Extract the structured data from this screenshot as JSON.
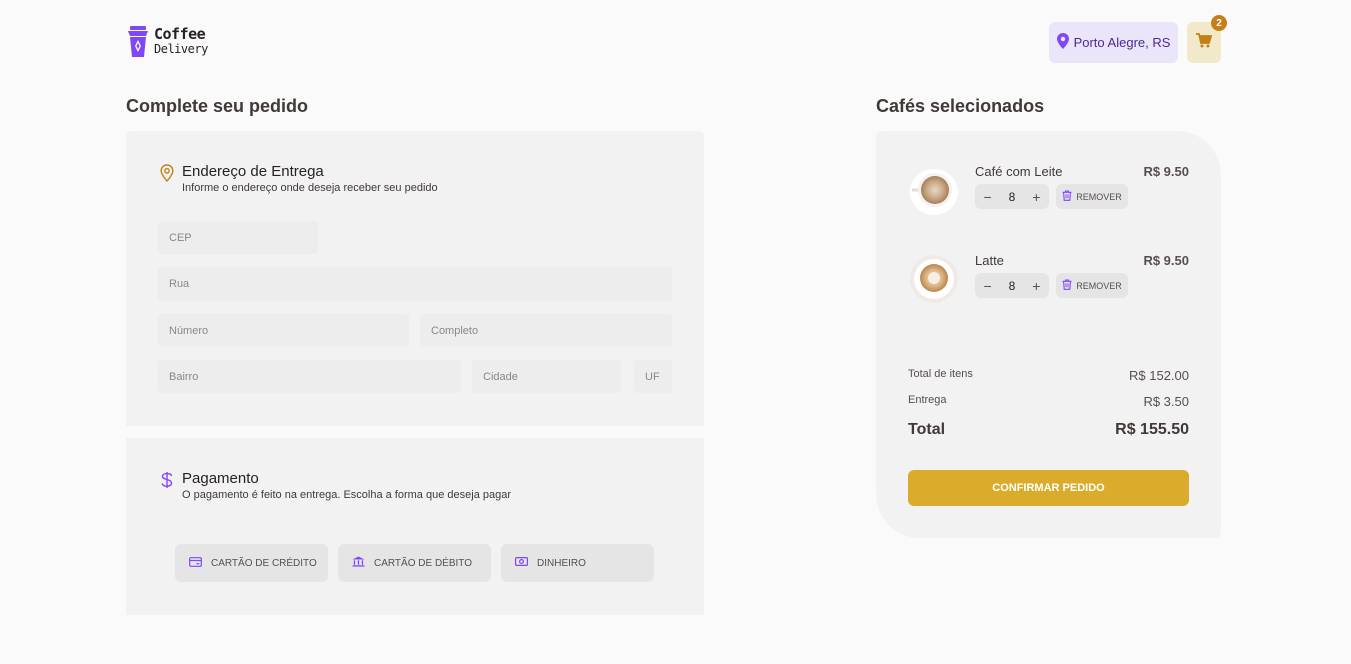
{
  "header": {
    "logo_line1": "Coffee",
    "logo_line2": "Delivery",
    "location": "Porto Alegre, RS",
    "cart_count": "2"
  },
  "checkout": {
    "title": "Complete seu pedido",
    "address": {
      "title": "Endereço de Entrega",
      "subtitle": "Informe o endereço onde deseja receber seu pedido",
      "placeholders": {
        "cep": "CEP",
        "rua": "Rua",
        "numero": "Número",
        "completo": "Completo",
        "bairro": "Bairro",
        "cidade": "Cidade",
        "uf": "UF"
      }
    },
    "payment": {
      "title": "Pagamento",
      "subtitle": "O pagamento é feito na entrega. Escolha a forma que deseja pagar",
      "options": [
        {
          "label": "CARTÃO DE CRÉDITO",
          "icon": "credit-card-icon"
        },
        {
          "label": "CARTÃO DE DÉBITO",
          "icon": "bank-icon"
        },
        {
          "label": "DINHEIRO",
          "icon": "money-icon"
        }
      ]
    }
  },
  "cart": {
    "title": "Cafés selecionados",
    "items": [
      {
        "name": "Café com Leite",
        "price": "R$ 9.50",
        "qty": "8",
        "remove": "REMOVER"
      },
      {
        "name": "Latte",
        "price": "R$ 9.50",
        "qty": "8",
        "remove": "REMOVER"
      }
    ],
    "summary": {
      "items_label": "Total de itens",
      "items_value": "R$ 152.00",
      "delivery_label": "Entrega",
      "delivery_value": "R$ 3.50",
      "total_label": "Total",
      "total_value": "R$ 155.50"
    },
    "confirm_label": "CONFIRMAR PEDIDO"
  },
  "colors": {
    "purple": "#8047f8",
    "purple_dark": "#4b2995",
    "yellow": "#dbac2c",
    "yellow_dark": "#c47f17",
    "background": "#fafafa",
    "card": "#f3f2f2"
  }
}
